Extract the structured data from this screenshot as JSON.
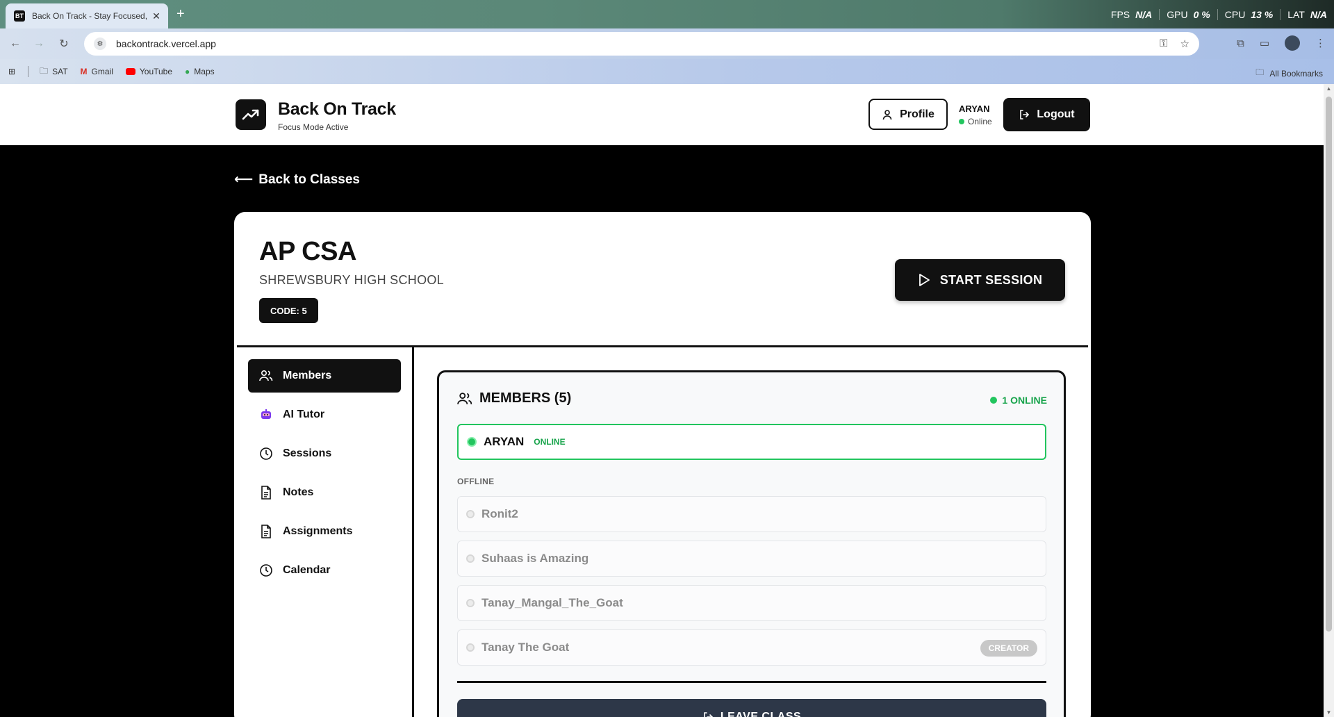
{
  "browser": {
    "tab_title": "Back On Track - Stay Focused, S",
    "favicon_text": "BT",
    "url": "backontrack.vercel.app",
    "perf": [
      {
        "label": "FPS",
        "value": "N/A"
      },
      {
        "label": "GPU",
        "value": "0 %"
      },
      {
        "label": "CPU",
        "value": "13 %"
      },
      {
        "label": "LAT",
        "value": "N/A"
      }
    ],
    "bookmarks": [
      "SAT",
      "Gmail",
      "YouTube",
      "Maps"
    ],
    "all_bookmarks": "All Bookmarks"
  },
  "header": {
    "brand_title": "Back On Track",
    "brand_subtitle": "Focus Mode Active",
    "profile_label": "Profile",
    "user_name": "ARYAN",
    "user_status": "Online",
    "logout_label": "Logout"
  },
  "back_link": "Back to Classes",
  "class_info": {
    "title": "AP CSA",
    "school": "SHREWSBURY HIGH SCHOOL",
    "code": "CODE: 5",
    "start_label": "START SESSION"
  },
  "sidebar": {
    "items": [
      {
        "label": "Members",
        "icon": "users-icon",
        "active": true
      },
      {
        "label": "AI Tutor",
        "icon": "robot-icon",
        "active": false
      },
      {
        "label": "Sessions",
        "icon": "clock-icon",
        "active": false
      },
      {
        "label": "Notes",
        "icon": "document-icon",
        "active": false
      },
      {
        "label": "Assignments",
        "icon": "document-icon",
        "active": false
      },
      {
        "label": "Calendar",
        "icon": "clock-icon",
        "active": false
      }
    ]
  },
  "members": {
    "title": "MEMBERS (5)",
    "online_count": "1 ONLINE",
    "online": [
      {
        "name": "ARYAN",
        "status": "ONLINE"
      }
    ],
    "offline_label": "OFFLINE",
    "offline": [
      {
        "name": "Ronit2",
        "badge": ""
      },
      {
        "name": "Suhaas is Amazing",
        "badge": ""
      },
      {
        "name": "Tanay_Mangal_The_Goat",
        "badge": ""
      },
      {
        "name": "Tanay The Goat",
        "badge": "CREATOR"
      }
    ],
    "leave_label": "LEAVE CLASS"
  },
  "colors": {
    "accent": "#111111",
    "online_green": "#22c55e",
    "leave_button": "#2d3748"
  }
}
